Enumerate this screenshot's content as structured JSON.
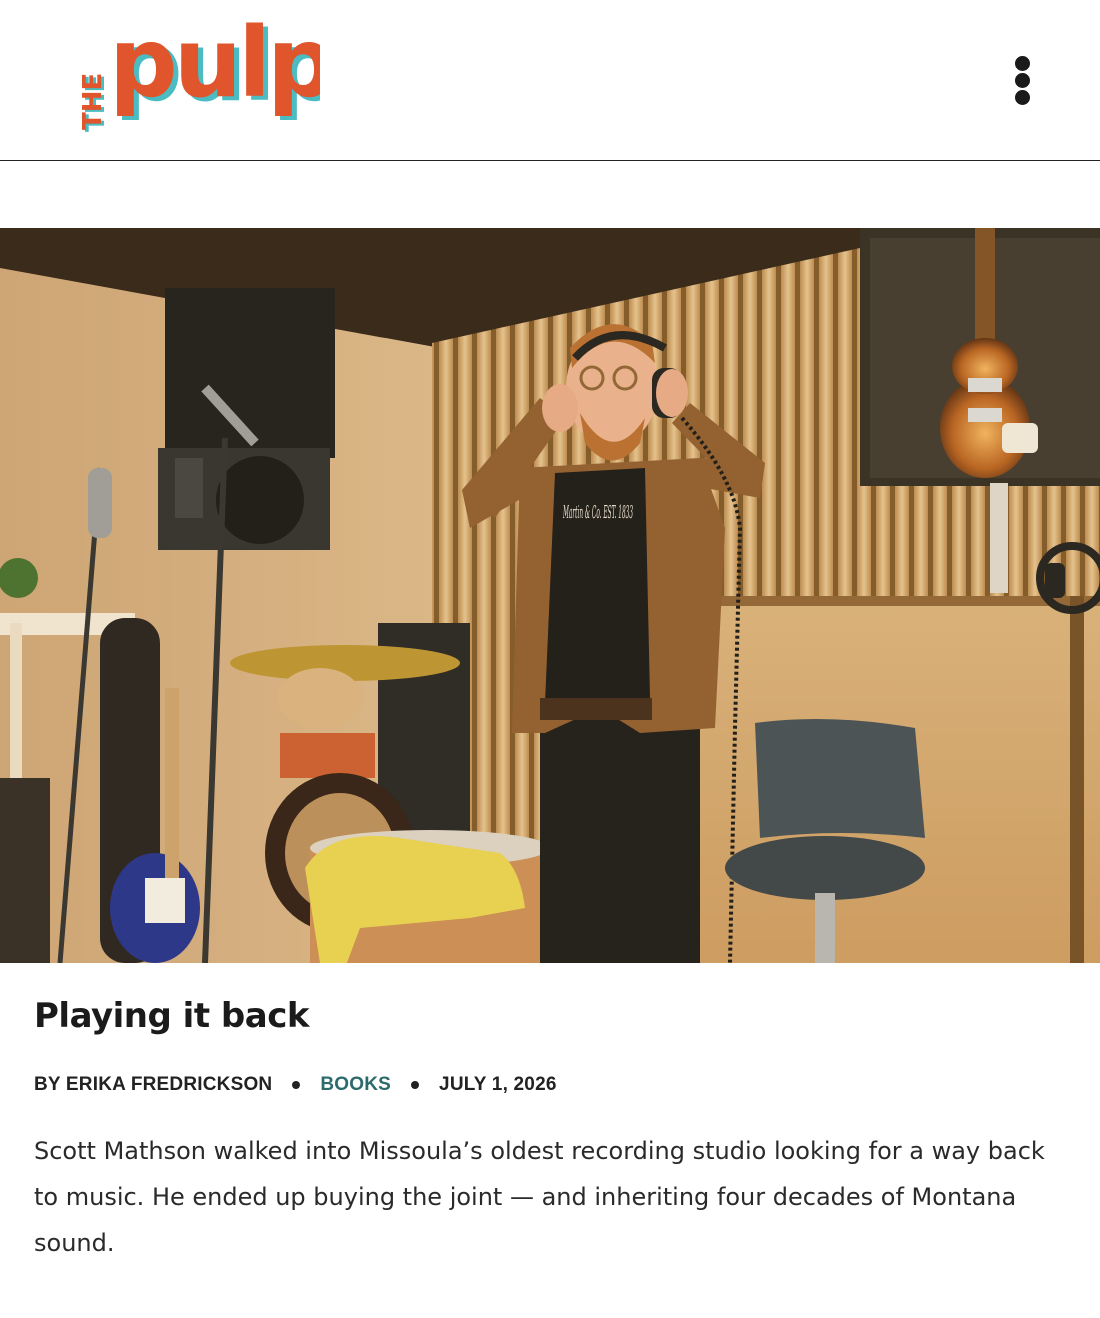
{
  "site": {
    "logo_small": "THE",
    "logo_main": "pulp",
    "brand_orange": "#e0552b",
    "brand_teal": "#4bbcc2",
    "menu_icon": "vertical-ellipsis-icon"
  },
  "article": {
    "title": "Playing it back",
    "byline": "BY ERIKA FREDRICKSON",
    "category": "BOOKS",
    "date": "JULY 1, 2026",
    "category_color": "#2c6a6e",
    "excerpt": "Scott Mathson walked into Missoula’s oldest recording studio looking for a way back to music. He ended up buying the joint — and inheriting four decades of Montana sound.",
    "shirt_text": "Martin & Co. EST. 1833"
  }
}
